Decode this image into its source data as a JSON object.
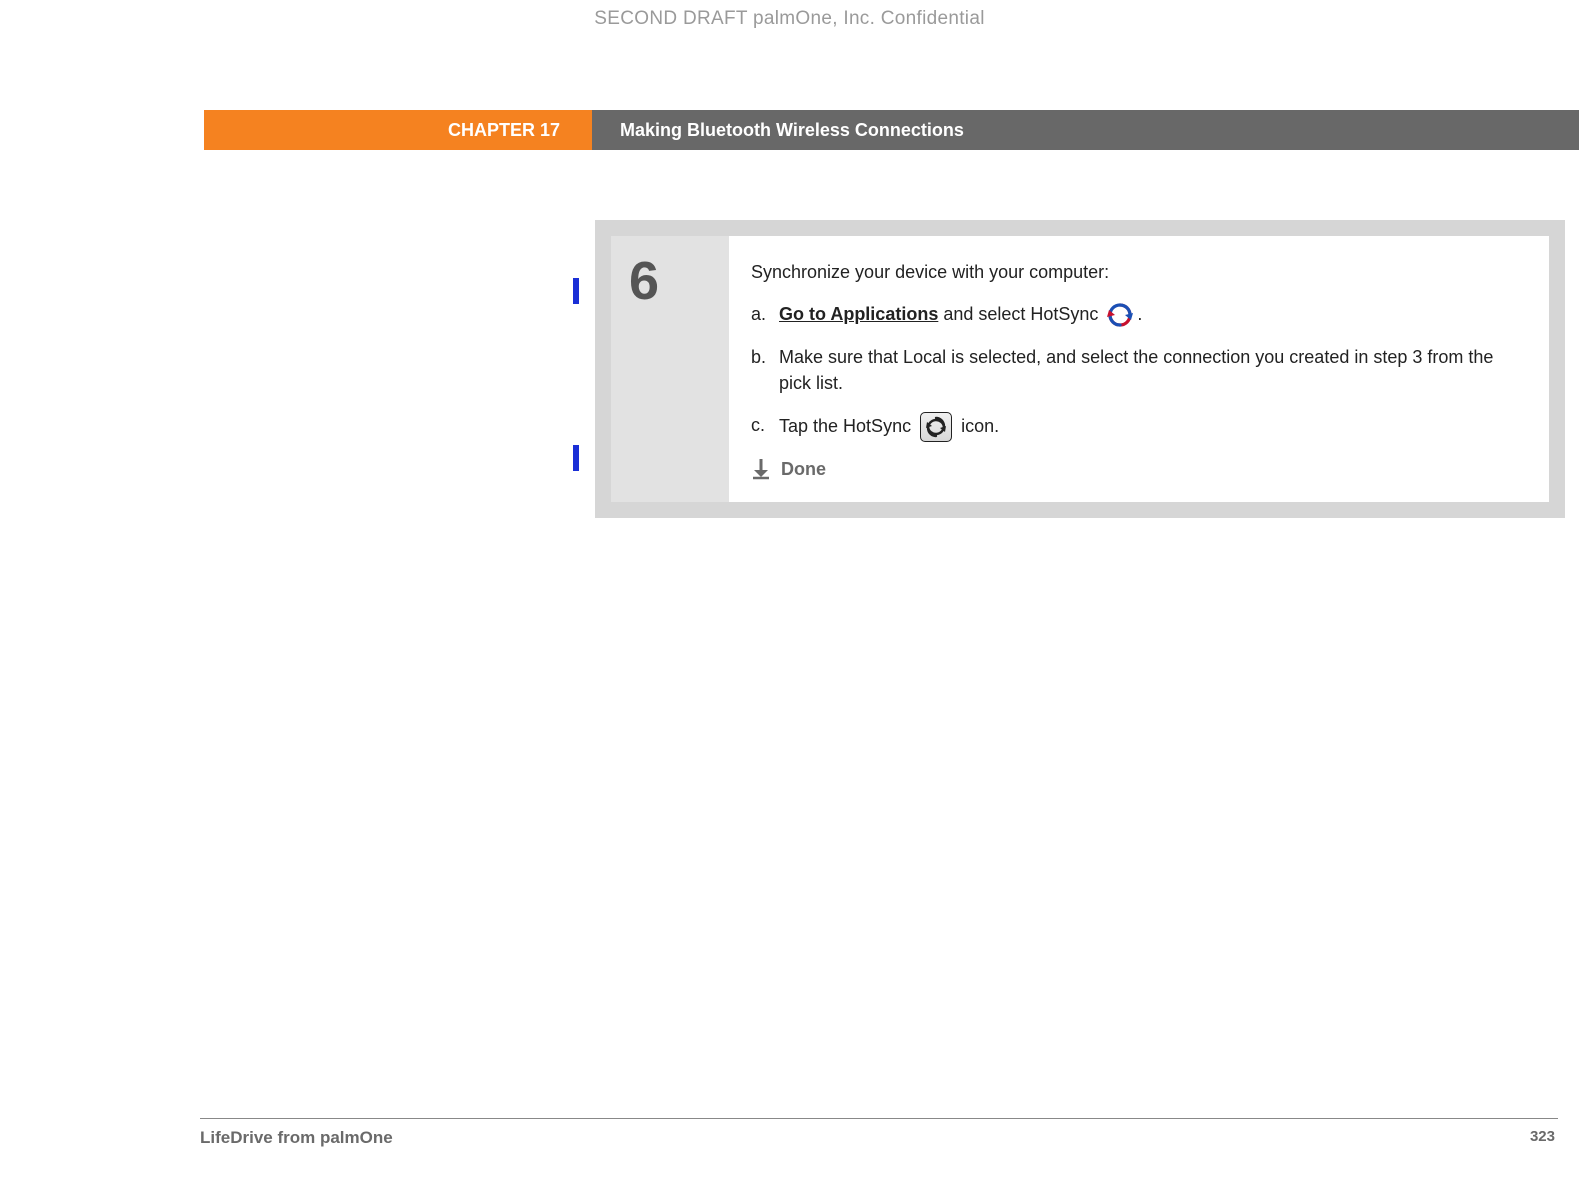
{
  "watermark": "SECOND DRAFT palmOne, Inc.  Confidential",
  "header": {
    "chapter": "CHAPTER 17",
    "title": "Making Bluetooth Wireless Connections"
  },
  "step": {
    "number": "6",
    "intro": "Synchronize your device with your computer:",
    "items": [
      {
        "bullet": "a.",
        "link_text": "Go to Applications",
        "rest": " and select HotSync ",
        "tail": "."
      },
      {
        "bullet": "b.",
        "text": "Make sure that Local is selected, and select the connection you created in step 3 from the pick list."
      },
      {
        "bullet": "c.",
        "pre": "Tap the HotSync ",
        "post": " icon."
      }
    ],
    "done_label": "Done"
  },
  "footer": {
    "product": "LifeDrive from palmOne",
    "page": "323"
  }
}
